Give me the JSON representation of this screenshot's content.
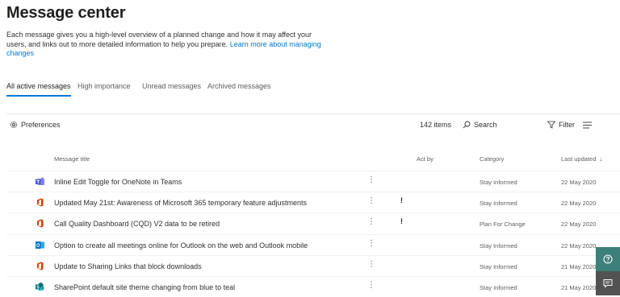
{
  "header": {
    "title": "Message center",
    "description": "Each message gives you a high-level overview of a planned change and how it may affect your users, and links out to more detailed information to help you prepare.",
    "learn_more": "Learn more about managing changes"
  },
  "tabs": [
    {
      "label": "All active messages",
      "active": true
    },
    {
      "label": "High importance",
      "active": false
    },
    {
      "label": "Unread messages",
      "active": false
    },
    {
      "label": "Archived messages",
      "active": false
    }
  ],
  "toolbar": {
    "preferences": "Preferences",
    "count": "142 items",
    "search": "Search",
    "filter": "Filter"
  },
  "columns": {
    "title": "Message title",
    "act_by": "Act by",
    "category": "Category",
    "last_updated": "Last updated"
  },
  "rows": [
    {
      "app": "teams-icon",
      "title": "Inline Edit Toggle for OneNote in Teams",
      "act": "",
      "category": "Stay Informed",
      "date": "22 May 2020"
    },
    {
      "app": "office-icon",
      "title": "Updated May 21st: Awareness of Microsoft 365 temporary feature adjustments",
      "act": "!",
      "category": "Stay Informed",
      "date": "22 May 2020"
    },
    {
      "app": "office-icon",
      "title": "Call Quality Dashboard (CQD) V2 data to be retired",
      "act": "!",
      "category": "Plan For Change",
      "date": "22 May 2020"
    },
    {
      "app": "outlook-icon",
      "title": "Option to create all meetings online for Outlook on the web and Outlook mobile",
      "act": "",
      "category": "Stay Informed",
      "date": "22 May 2020"
    },
    {
      "app": "office-icon",
      "title": "Update to Sharing Links that block downloads",
      "act": "",
      "category": "Stay Informed",
      "date": "21 May 2020"
    },
    {
      "app": "sharepoint-icon",
      "title": "SharePoint default site theme changing from blue to teal",
      "act": "",
      "category": "Stay Informed",
      "date": "21 May 2020"
    }
  ],
  "more_glyph": "⋮",
  "colors": {
    "accent": "#0078d4",
    "office": "#d83b01",
    "teams": "#5059c9",
    "outlook": "#0072c6",
    "side_help": "#3d7f7a",
    "side_feedback": "#525252"
  }
}
